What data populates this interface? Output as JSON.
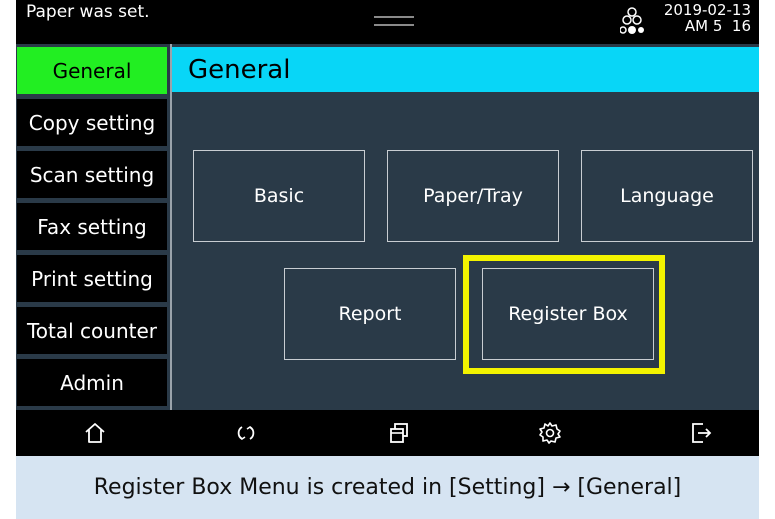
{
  "status_bar": {
    "message": "Paper was set.",
    "date": "2019-02-13",
    "time": "AM 5  16",
    "connection_icon": "connection-dots-icon"
  },
  "sidebar": {
    "items": [
      {
        "label": "General",
        "active": true
      },
      {
        "label": "Copy setting",
        "active": false
      },
      {
        "label": "Scan setting",
        "active": false
      },
      {
        "label": "Fax setting",
        "active": false
      },
      {
        "label": "Print setting",
        "active": false
      },
      {
        "label": "Total counter",
        "active": false
      },
      {
        "label": "Admin",
        "active": false
      }
    ]
  },
  "main": {
    "title": "General",
    "tiles": [
      {
        "label": "Basic"
      },
      {
        "label": "Paper/Tray"
      },
      {
        "label": "Language"
      },
      {
        "label": "Report"
      },
      {
        "label": "Register Box",
        "highlighted": true
      }
    ]
  },
  "nav_bar": {
    "icons": [
      "home-icon",
      "refresh-icon",
      "copy-windows-icon",
      "gear-icon",
      "logout-icon"
    ]
  },
  "caption": "Register Box Menu is created in [Setting] → [General]",
  "colors": {
    "active_tab": "#22ee22",
    "title_bar": "#08d6f7",
    "highlight": "#f3f300",
    "background": "#2a3a48",
    "caption_bg": "#d6e4f2"
  }
}
